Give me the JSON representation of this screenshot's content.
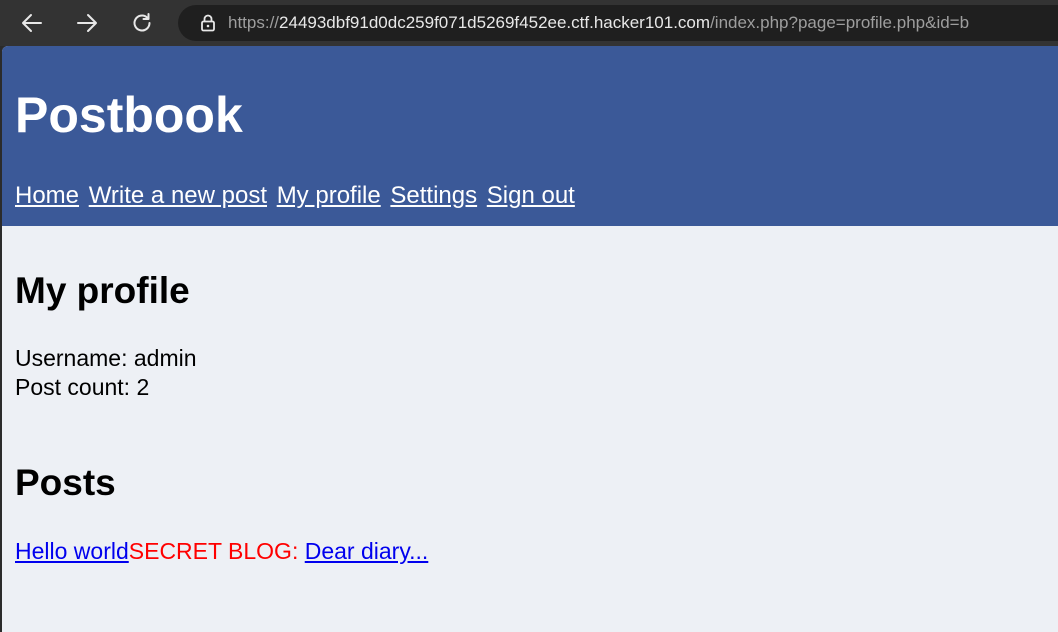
{
  "browser": {
    "url_scheme": "https://",
    "url_host": "24493dbf91d0dc259f071d5269f452ee.ctf.hacker101.com",
    "url_path": "/index.php?page=profile.php&id=b",
    "icons": [
      "back-arrow-icon",
      "forward-arrow-icon",
      "reload-icon",
      "lock-icon"
    ]
  },
  "header": {
    "title": "Postbook",
    "nav": [
      {
        "label": "Home"
      },
      {
        "label": "Write a new post"
      },
      {
        "label": "My profile"
      },
      {
        "label": "Settings"
      },
      {
        "label": "Sign out"
      }
    ]
  },
  "profile": {
    "heading": "My profile",
    "username_line": "Username: admin",
    "post_count_line": "Post count: 2"
  },
  "posts": {
    "heading": "Posts",
    "items": [
      {
        "prefix": "",
        "title": "Hello world"
      },
      {
        "prefix": "SECRET BLOG: ",
        "title": "Dear diary..."
      }
    ]
  },
  "colors": {
    "header_bg": "#3b5998",
    "page_bg": "#edf0f5",
    "link": "#0000ee",
    "secret": "#ff0000"
  }
}
